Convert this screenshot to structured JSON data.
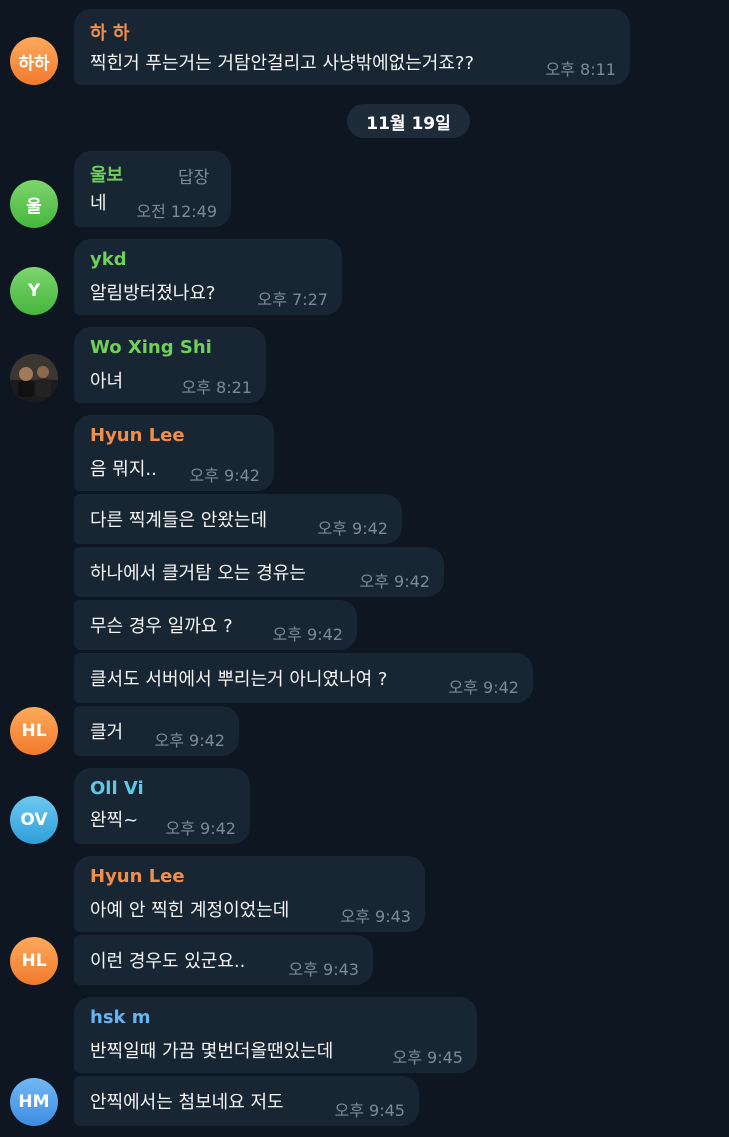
{
  "date_separator": "11월 19일",
  "colors": {
    "name_orange": "#f08f4b",
    "name_green": "#6fd05a",
    "name_cyan": "#5ec9e6",
    "name_blue": "#68b4f0",
    "bubble_bg": "#182533",
    "chat_bg": "#0e1621"
  },
  "messages": [
    {
      "sender": "하 하",
      "text": "찍힌거 푸는거는 거탐안걸리고 사냥밖에없는거죠??",
      "time": "오후 8:11",
      "avatar": "하하"
    },
    {
      "sender": "울보",
      "reply": "답장",
      "text": "네",
      "time": "오전 12:49",
      "avatar": "울"
    },
    {
      "sender": "ykd",
      "text": "알림방터졌나요?",
      "time": "오후 7:27",
      "avatar": "Y"
    },
    {
      "sender": "Wo Xing Shi",
      "text": "아녀",
      "time": "오후 8:21",
      "avatar": "photo"
    },
    {
      "sender": "Hyun Lee",
      "text": "음 뭐지..",
      "time": "오후 9:42"
    },
    {
      "text": "다른 찍계들은 안왔는데",
      "time": "오후 9:42"
    },
    {
      "text": "하나에서 클거탐 오는 경유는",
      "time": "오후 9:42"
    },
    {
      "text": "무슨 경우 일까요 ?",
      "time": "오후 9:42"
    },
    {
      "text": "클서도 서버에서 뿌리는거 아니였나여 ?",
      "time": "오후 9:42"
    },
    {
      "text": "클거",
      "time": "오후 9:42",
      "avatar": "HL"
    },
    {
      "sender": "Oll Vi",
      "text": "완찍~",
      "time": "오후 9:42",
      "avatar": "OV"
    },
    {
      "sender": "Hyun Lee",
      "text": "아예 안 찍힌 계정이었는데",
      "time": "오후 9:43"
    },
    {
      "text": "이런 경우도 있군요..",
      "time": "오후 9:43",
      "avatar": "HL"
    },
    {
      "sender": "hsk m",
      "text": "반찍일때 가끔 몇번더올땐있는데",
      "time": "오후 9:45"
    },
    {
      "text": "안찍에서는 첨보네요 저도",
      "time": "오후 9:45",
      "avatar": "HM"
    }
  ]
}
